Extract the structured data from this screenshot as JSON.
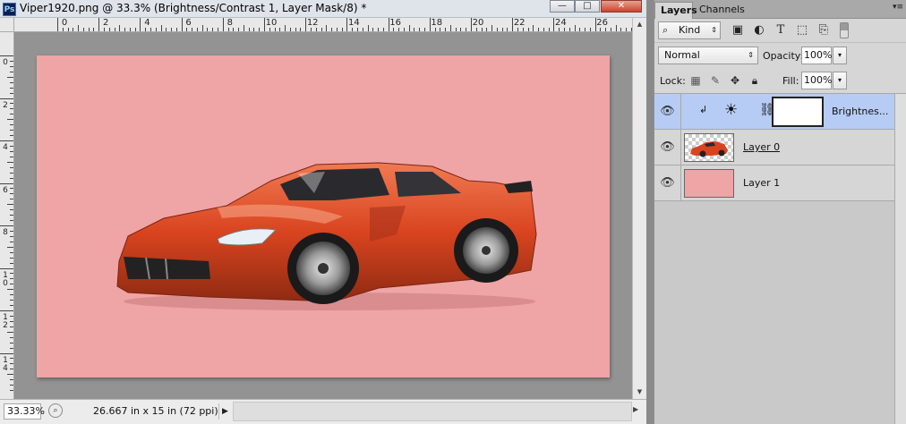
{
  "document": {
    "title": "Viper1920.png @ 33.3% (Brightness/Contrast 1, Layer Mask/8) *",
    "app_icon": "Ps",
    "window_buttons": {
      "minimize": "—",
      "maximize": "□",
      "close": "✕"
    },
    "ruler_h_labels": [
      "0",
      "2",
      "4",
      "6",
      "8",
      "10",
      "12",
      "14",
      "16",
      "18",
      "20",
      "22",
      "24",
      "26"
    ],
    "ruler_v_labels": [
      "0",
      "2",
      "4",
      "6",
      "8",
      "1 0",
      "1 2",
      "1 4"
    ],
    "canvas_color": "#efa4a6",
    "car_color": "#d9441f"
  },
  "status": {
    "zoom": "33.33%",
    "doc_size": "26.667 in x 15 in (72 ppi)",
    "menu_arrow": "▶"
  },
  "layers_panel": {
    "tabs": [
      "Layers",
      "Channels"
    ],
    "menu_icon": "▾≡",
    "filter": {
      "kind_label": "Kind",
      "search_icon": "⌕",
      "arrow": "⇕"
    },
    "blend_mode": "Normal",
    "blend_arrow": "⇕",
    "opacity_label": "Opacity:",
    "opacity_value": "100%",
    "fill_label": "Fill:",
    "fill_value": "100%",
    "lock_label": "Lock:",
    "dropdown_arrow": "▾",
    "layers": [
      {
        "name": "Brightnes...",
        "type": "adjustment",
        "selected": true
      },
      {
        "name": "Layer 0",
        "type": "image"
      },
      {
        "name": "Layer 1",
        "type": "fill"
      }
    ],
    "selected_color": "#b6ccf5"
  }
}
